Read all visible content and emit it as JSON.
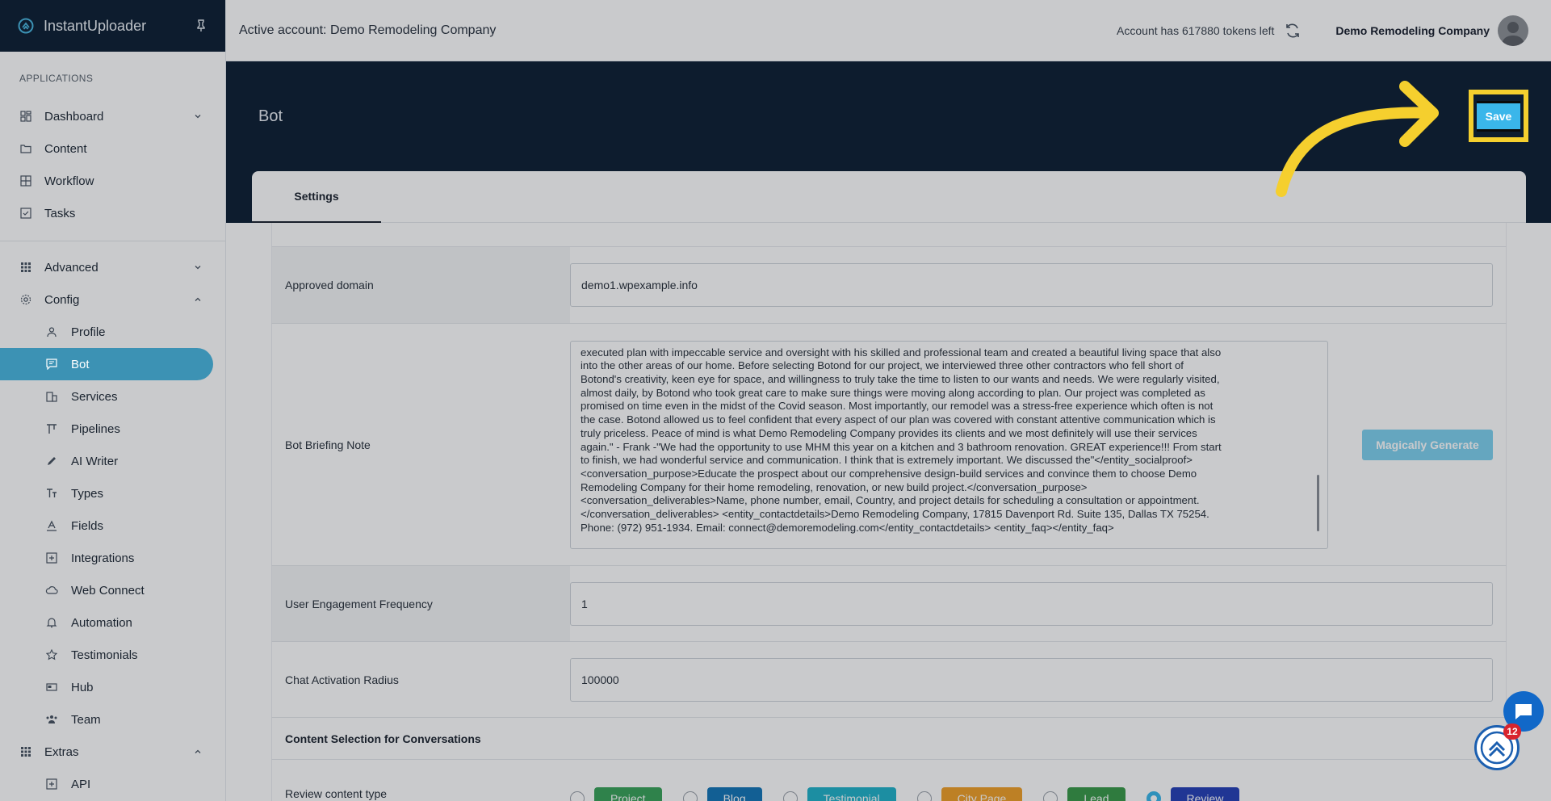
{
  "app": {
    "name": "InstantUploader"
  },
  "sidebar": {
    "section_title": "APPLICATIONS",
    "items_top": [
      {
        "label": "Dashboard",
        "icon": "dashboard-icon",
        "chevron": "chevron-down-icon"
      },
      {
        "label": "Content",
        "icon": "folder-icon"
      },
      {
        "label": "Workflow",
        "icon": "grid-icon"
      },
      {
        "label": "Tasks",
        "icon": "check-square-icon"
      }
    ],
    "advanced": {
      "label": "Advanced",
      "icon": "grid-dots-icon"
    },
    "config": {
      "label": "Config",
      "icon": "gear-icon"
    },
    "config_items": [
      {
        "label": "Profile",
        "icon": "user-icon"
      },
      {
        "label": "Bot",
        "icon": "chat-icon",
        "active": true
      },
      {
        "label": "Services",
        "icon": "building-icon"
      },
      {
        "label": "Pipelines",
        "icon": "pipeline-icon"
      },
      {
        "label": "AI Writer",
        "icon": "pencil-icon"
      },
      {
        "label": "Types",
        "icon": "text-type-icon"
      },
      {
        "label": "Fields",
        "icon": "field-icon"
      },
      {
        "label": "Integrations",
        "icon": "plus-square-icon"
      },
      {
        "label": "Web Connect",
        "icon": "cloud-icon"
      },
      {
        "label": "Automation",
        "icon": "bell-icon"
      },
      {
        "label": "Testimonials",
        "icon": "star-icon"
      },
      {
        "label": "Hub",
        "icon": "hub-icon"
      },
      {
        "label": "Team",
        "icon": "team-icon"
      }
    ],
    "extras": {
      "label": "Extras",
      "icon": "grid-dots-icon"
    },
    "extras_items": [
      {
        "label": "API",
        "icon": "plus-square-icon"
      }
    ]
  },
  "topbar": {
    "active_account": "Active account: Demo Remodeling Company",
    "tokens": "Account has 617880 tokens left",
    "company": "Demo Remodeling Company"
  },
  "header": {
    "title": "Bot",
    "save_label": "Save"
  },
  "tabs": {
    "settings": "Settings"
  },
  "form": {
    "approved_domain": {
      "label": "Approved domain",
      "value": "demo1.wpexample.info"
    },
    "briefing": {
      "label": "Bot Briefing Note",
      "lines": [
        "executed plan with impeccable service and oversight with his skilled and professional team and created a beautiful living space that also",
        "into the other areas of our home. Before selecting Botond for our project, we interviewed three other contractors who fell short of",
        "Botond's creativity, keen eye for space, and willingness to truly take the time to listen to our wants and needs. We were regularly visited,",
        "almost daily, by Botond who took great care to make sure things were moving along according to plan. Our project was completed as",
        "promised on time even in the midst of the Covid season. Most importantly, our remodel was a stress-free experience which often is not",
        "the case. Botond allowed us to feel confident that every aspect of our plan was covered with constant attentive communication which is",
        "truly priceless. Peace of mind is what Demo Remodeling Company provides its clients and we most definitely will use their services",
        "again.\" - Frank -\"We had the opportunity to use MHM this year on a kitchen and 3 bathroom renovation. GREAT experience!!! From start",
        "to finish, we had wonderful service and communication. I think that is extremely important. We discussed the\"</entity_socialproof>",
        "<conversation_purpose>Educate the prospect about our comprehensive design-build services and convince them to choose Demo",
        "Remodeling Company for their home remodeling, renovation, or new build project.</conversation_purpose>",
        "<conversation_deliverables>Name, phone number, email, Country, and project details for scheduling a consultation or appointment.",
        "</conversation_deliverables> <entity_contactdetails>Demo Remodeling Company, 17815 Davenport Rd. Suite 135, Dallas TX 75254.",
        "Phone: (972) 951-1934. Email: connect@demoremodeling.com</entity_contactdetails> <entity_faq></entity_faq>"
      ],
      "generate_label": "Magically Generate"
    },
    "engagement": {
      "label": "User Engagement Frequency",
      "value": "1"
    },
    "radius": {
      "label": "Chat Activation Radius",
      "value": "100000"
    },
    "content_section": "Content Selection for Conversations",
    "review_type": {
      "label": "Review content type",
      "options": [
        {
          "label": "Project",
          "color": "#3aa35a",
          "selected": false
        },
        {
          "label": "Blog",
          "color": "#1577b8",
          "selected": false
        },
        {
          "label": "Testimonial",
          "color": "#22b3c9",
          "selected": false
        },
        {
          "label": "City Page",
          "color": "#f0a02a",
          "selected": false
        },
        {
          "label": "Lead",
          "color": "#3a9a4a",
          "selected": false
        },
        {
          "label": "Review",
          "color": "#2742b8",
          "selected": true
        }
      ]
    }
  },
  "floating": {
    "badge_count": "12"
  },
  "colors": {
    "navy": "#0f2035",
    "accent": "#4bb8e0",
    "highlight": "#f5cf2e"
  }
}
